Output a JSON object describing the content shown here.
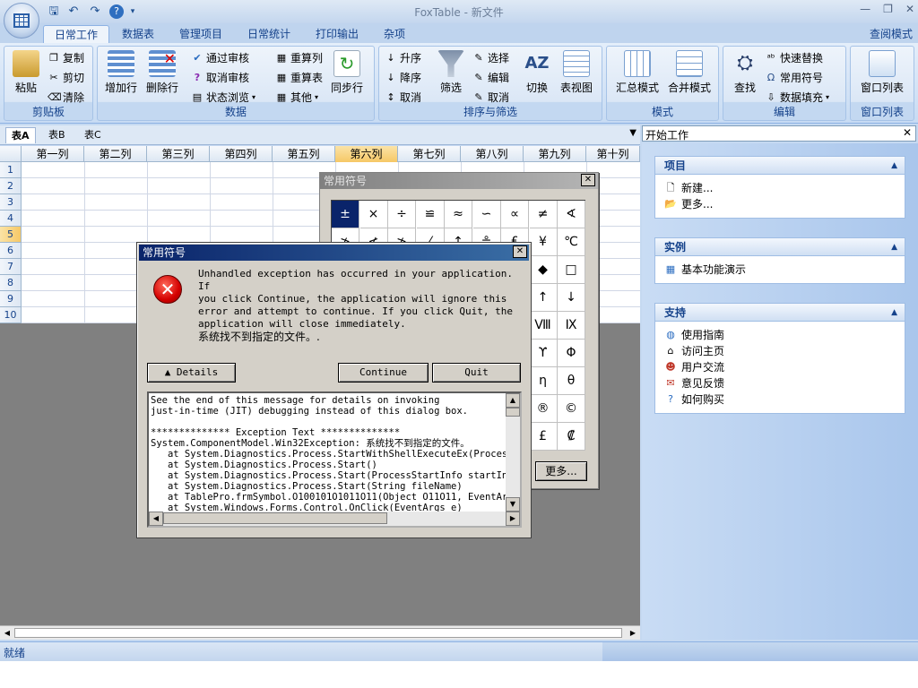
{
  "window": {
    "title": "FoxTable - 新文件",
    "read_mode": "查阅模式",
    "min": "—",
    "restore": "❐",
    "close": "✕"
  },
  "ribbon_tabs": [
    "日常工作",
    "数据表",
    "管理项目",
    "日常统计",
    "打印输出",
    "杂项"
  ],
  "groups": {
    "clipboard": {
      "label": "剪贴板",
      "paste": "粘贴",
      "copy": "复制",
      "cut": "剪切",
      "clear": "清除"
    },
    "data": {
      "label": "数据",
      "add_row": "增加行",
      "delete_row": "删除行",
      "approve": "通过审核",
      "unapprove": "取消审核",
      "status_browse": "状态浏览",
      "recalc_col": "重算列",
      "recalc_table": "重算表",
      "other": "其他",
      "sync_row": "同步行"
    },
    "sort": {
      "label": "排序与筛选",
      "asc": "升序",
      "desc": "降序",
      "cancel": "取消",
      "filter": "筛选",
      "select": "选择",
      "edit": "编辑",
      "cancel2": "取消",
      "toggle": "切换",
      "table_view": "表视图"
    },
    "mode": {
      "label": "模式",
      "summary": "汇总模式",
      "merge": "合并模式"
    },
    "edit": {
      "label": "编辑",
      "find": "查找",
      "quick_replace": "快速替换",
      "common_symbols": "常用符号",
      "data_fill": "数据填充"
    },
    "window_list": {
      "label": "窗口列表",
      "btn": "窗口列表"
    }
  },
  "sheet_tabs": [
    "表A",
    "表B",
    "表C"
  ],
  "columns": [
    "第一列",
    "第二列",
    "第三列",
    "第四列",
    "第五列",
    "第六列",
    "第七列",
    "第八列",
    "第九列",
    "第十列"
  ],
  "rows": [
    "1",
    "2",
    "3",
    "4",
    "5",
    "6",
    "7",
    "8",
    "9",
    "10"
  ],
  "right_pane": {
    "title": "开始工作",
    "panels": [
      {
        "title": "项目",
        "items": [
          "新建...",
          "更多..."
        ]
      },
      {
        "title": "实例",
        "items": [
          "基本功能演示"
        ]
      },
      {
        "title": "支持",
        "items": [
          "使用指南",
          "访问主页",
          "用户交流",
          "意见反馈",
          "如何购买"
        ]
      }
    ]
  },
  "status": {
    "text": "就绪"
  },
  "symbol_dialog": {
    "title": "常用符号",
    "symbols": [
      "±",
      "×",
      "÷",
      "≌",
      "≈",
      "∽",
      "∝",
      "≠",
      "∢",
      "≯",
      "≮",
      "≯",
      "⁄",
      "↑",
      "≗",
      "₤",
      "¥",
      "℃",
      "",
      "",
      "",
      "",
      "",
      "",
      "",
      "◆",
      "□",
      "",
      "",
      "",
      "",
      "",
      "",
      "",
      "↑",
      "↓",
      "",
      "",
      "",
      "",
      "",
      "",
      "",
      "Ⅷ",
      "Ⅸ",
      "",
      "",
      "",
      "",
      "",
      "",
      "",
      "ϒ",
      "Φ",
      "",
      "",
      "",
      "",
      "",
      "",
      "",
      "η",
      "θ",
      "",
      "",
      "",
      "",
      "",
      "",
      "",
      "®",
      "©",
      "",
      "",
      "",
      "",
      "",
      "",
      "",
      "£",
      "₡"
    ],
    "more": "更多..."
  },
  "error_dialog": {
    "title": "常用符号",
    "message": "Unhandled exception has occurred in your application. If\nyou click Continue, the application will ignore this\nerror and attempt to continue. If you click Quit, the\napplication will close immediately.",
    "sub": "系统找不到指定的文件。.",
    "details": "▲  Details",
    "continue": "Continue",
    "quit": "Quit",
    "trace": "See the end of this message for details on invoking\njust-in-time (JIT) debugging instead of this dialog box.\n\n************** Exception Text **************\nSystem.ComponentModel.Win32Exception: 系统找不到指定的文件。\n   at System.Diagnostics.Process.StartWithShellExecuteEx(ProcessSt\n   at System.Diagnostics.Process.Start()\n   at System.Diagnostics.Process.Start(ProcessStartInfo startInfo)\n   at System.Diagnostics.Process.Start(String fileName)\n   at TablePro.frmSymbol.O100101O1011O11(Object O11O11, EventArgs O)\n   at System.Windows.Forms.Control.OnClick(EventArgs e)"
  }
}
